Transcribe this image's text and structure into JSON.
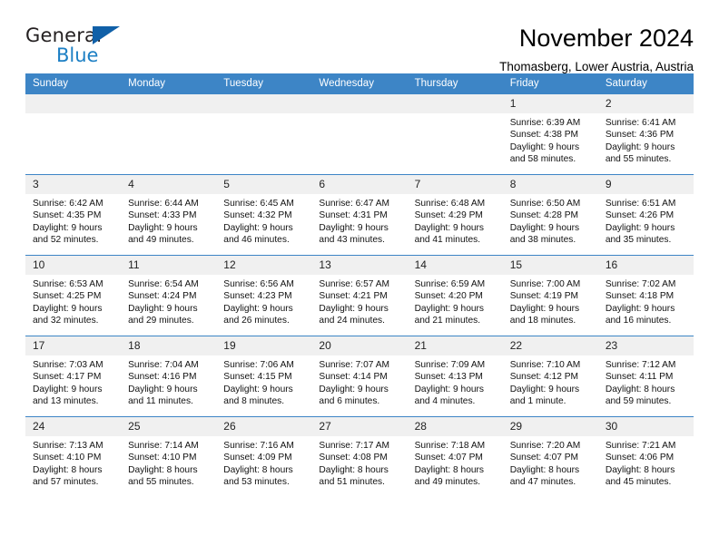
{
  "brand": {
    "name_part1": "General",
    "name_part2": "Blue",
    "triangle_color": "#1060a8",
    "blue_text_color": "#1c7fc4"
  },
  "header": {
    "title": "November 2024",
    "subtitle": "Thomasberg, Lower Austria, Austria"
  },
  "theme": {
    "header_row_bg": "#3d85c6",
    "daynum_bg": "#f0f0f0",
    "cell_bg": "#ffffff",
    "text_color": "#000000"
  },
  "calendar": {
    "weekday_headers": [
      "Sunday",
      "Monday",
      "Tuesday",
      "Wednesday",
      "Thursday",
      "Friday",
      "Saturday"
    ],
    "weeks": [
      [
        {
          "day": "",
          "blank": true
        },
        {
          "day": "",
          "blank": true
        },
        {
          "day": "",
          "blank": true
        },
        {
          "day": "",
          "blank": true
        },
        {
          "day": "",
          "blank": true
        },
        {
          "day": "1",
          "sunrise": "Sunrise: 6:39 AM",
          "sunset": "Sunset: 4:38 PM",
          "daylight": "Daylight: 9 hours and 58 minutes."
        },
        {
          "day": "2",
          "sunrise": "Sunrise: 6:41 AM",
          "sunset": "Sunset: 4:36 PM",
          "daylight": "Daylight: 9 hours and 55 minutes."
        }
      ],
      [
        {
          "day": "3",
          "sunrise": "Sunrise: 6:42 AM",
          "sunset": "Sunset: 4:35 PM",
          "daylight": "Daylight: 9 hours and 52 minutes."
        },
        {
          "day": "4",
          "sunrise": "Sunrise: 6:44 AM",
          "sunset": "Sunset: 4:33 PM",
          "daylight": "Daylight: 9 hours and 49 minutes."
        },
        {
          "day": "5",
          "sunrise": "Sunrise: 6:45 AM",
          "sunset": "Sunset: 4:32 PM",
          "daylight": "Daylight: 9 hours and 46 minutes."
        },
        {
          "day": "6",
          "sunrise": "Sunrise: 6:47 AM",
          "sunset": "Sunset: 4:31 PM",
          "daylight": "Daylight: 9 hours and 43 minutes."
        },
        {
          "day": "7",
          "sunrise": "Sunrise: 6:48 AM",
          "sunset": "Sunset: 4:29 PM",
          "daylight": "Daylight: 9 hours and 41 minutes."
        },
        {
          "day": "8",
          "sunrise": "Sunrise: 6:50 AM",
          "sunset": "Sunset: 4:28 PM",
          "daylight": "Daylight: 9 hours and 38 minutes."
        },
        {
          "day": "9",
          "sunrise": "Sunrise: 6:51 AM",
          "sunset": "Sunset: 4:26 PM",
          "daylight": "Daylight: 9 hours and 35 minutes."
        }
      ],
      [
        {
          "day": "10",
          "sunrise": "Sunrise: 6:53 AM",
          "sunset": "Sunset: 4:25 PM",
          "daylight": "Daylight: 9 hours and 32 minutes."
        },
        {
          "day": "11",
          "sunrise": "Sunrise: 6:54 AM",
          "sunset": "Sunset: 4:24 PM",
          "daylight": "Daylight: 9 hours and 29 minutes."
        },
        {
          "day": "12",
          "sunrise": "Sunrise: 6:56 AM",
          "sunset": "Sunset: 4:23 PM",
          "daylight": "Daylight: 9 hours and 26 minutes."
        },
        {
          "day": "13",
          "sunrise": "Sunrise: 6:57 AM",
          "sunset": "Sunset: 4:21 PM",
          "daylight": "Daylight: 9 hours and 24 minutes."
        },
        {
          "day": "14",
          "sunrise": "Sunrise: 6:59 AM",
          "sunset": "Sunset: 4:20 PM",
          "daylight": "Daylight: 9 hours and 21 minutes."
        },
        {
          "day": "15",
          "sunrise": "Sunrise: 7:00 AM",
          "sunset": "Sunset: 4:19 PM",
          "daylight": "Daylight: 9 hours and 18 minutes."
        },
        {
          "day": "16",
          "sunrise": "Sunrise: 7:02 AM",
          "sunset": "Sunset: 4:18 PM",
          "daylight": "Daylight: 9 hours and 16 minutes."
        }
      ],
      [
        {
          "day": "17",
          "sunrise": "Sunrise: 7:03 AM",
          "sunset": "Sunset: 4:17 PM",
          "daylight": "Daylight: 9 hours and 13 minutes."
        },
        {
          "day": "18",
          "sunrise": "Sunrise: 7:04 AM",
          "sunset": "Sunset: 4:16 PM",
          "daylight": "Daylight: 9 hours and 11 minutes."
        },
        {
          "day": "19",
          "sunrise": "Sunrise: 7:06 AM",
          "sunset": "Sunset: 4:15 PM",
          "daylight": "Daylight: 9 hours and 8 minutes."
        },
        {
          "day": "20",
          "sunrise": "Sunrise: 7:07 AM",
          "sunset": "Sunset: 4:14 PM",
          "daylight": "Daylight: 9 hours and 6 minutes."
        },
        {
          "day": "21",
          "sunrise": "Sunrise: 7:09 AM",
          "sunset": "Sunset: 4:13 PM",
          "daylight": "Daylight: 9 hours and 4 minutes."
        },
        {
          "day": "22",
          "sunrise": "Sunrise: 7:10 AM",
          "sunset": "Sunset: 4:12 PM",
          "daylight": "Daylight: 9 hours and 1 minute."
        },
        {
          "day": "23",
          "sunrise": "Sunrise: 7:12 AM",
          "sunset": "Sunset: 4:11 PM",
          "daylight": "Daylight: 8 hours and 59 minutes."
        }
      ],
      [
        {
          "day": "24",
          "sunrise": "Sunrise: 7:13 AM",
          "sunset": "Sunset: 4:10 PM",
          "daylight": "Daylight: 8 hours and 57 minutes."
        },
        {
          "day": "25",
          "sunrise": "Sunrise: 7:14 AM",
          "sunset": "Sunset: 4:10 PM",
          "daylight": "Daylight: 8 hours and 55 minutes."
        },
        {
          "day": "26",
          "sunrise": "Sunrise: 7:16 AM",
          "sunset": "Sunset: 4:09 PM",
          "daylight": "Daylight: 8 hours and 53 minutes."
        },
        {
          "day": "27",
          "sunrise": "Sunrise: 7:17 AM",
          "sunset": "Sunset: 4:08 PM",
          "daylight": "Daylight: 8 hours and 51 minutes."
        },
        {
          "day": "28",
          "sunrise": "Sunrise: 7:18 AM",
          "sunset": "Sunset: 4:07 PM",
          "daylight": "Daylight: 8 hours and 49 minutes."
        },
        {
          "day": "29",
          "sunrise": "Sunrise: 7:20 AM",
          "sunset": "Sunset: 4:07 PM",
          "daylight": "Daylight: 8 hours and 47 minutes."
        },
        {
          "day": "30",
          "sunrise": "Sunrise: 7:21 AM",
          "sunset": "Sunset: 4:06 PM",
          "daylight": "Daylight: 8 hours and 45 minutes."
        }
      ]
    ]
  }
}
